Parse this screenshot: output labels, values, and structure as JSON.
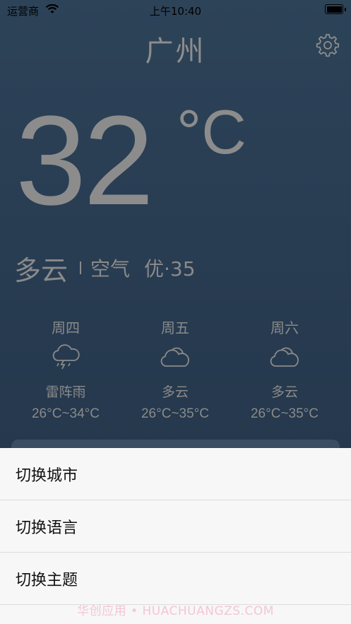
{
  "status_bar": {
    "carrier": "运营商",
    "time": "上午10:40"
  },
  "header": {
    "city": "广州",
    "settings_icon": "gear-icon"
  },
  "current": {
    "temperature": "32",
    "unit": "°C",
    "condition": "多云",
    "air_label": "空气",
    "air_value": "优·35"
  },
  "forecast": [
    {
      "day": "周四",
      "icon": "thunderstorm-cloud-icon",
      "desc": "雷阵雨",
      "range": "26°C~34°C"
    },
    {
      "day": "周五",
      "icon": "cloud-icon",
      "desc": "多云",
      "range": "26°C~35°C"
    },
    {
      "day": "周六",
      "icon": "cloud-icon",
      "desc": "多云",
      "range": "26°C~35°C"
    }
  ],
  "action_sheet": {
    "items": [
      "切换城市",
      "切换语言",
      "切换主题"
    ]
  },
  "watermark": "华创应用 • HUACHUANGZS.COM",
  "colors": {
    "background_top": "#2d4358",
    "background_bottom": "#233548",
    "text_gray": "#8a8a8a",
    "sheet_bg": "#f7f7f7"
  }
}
